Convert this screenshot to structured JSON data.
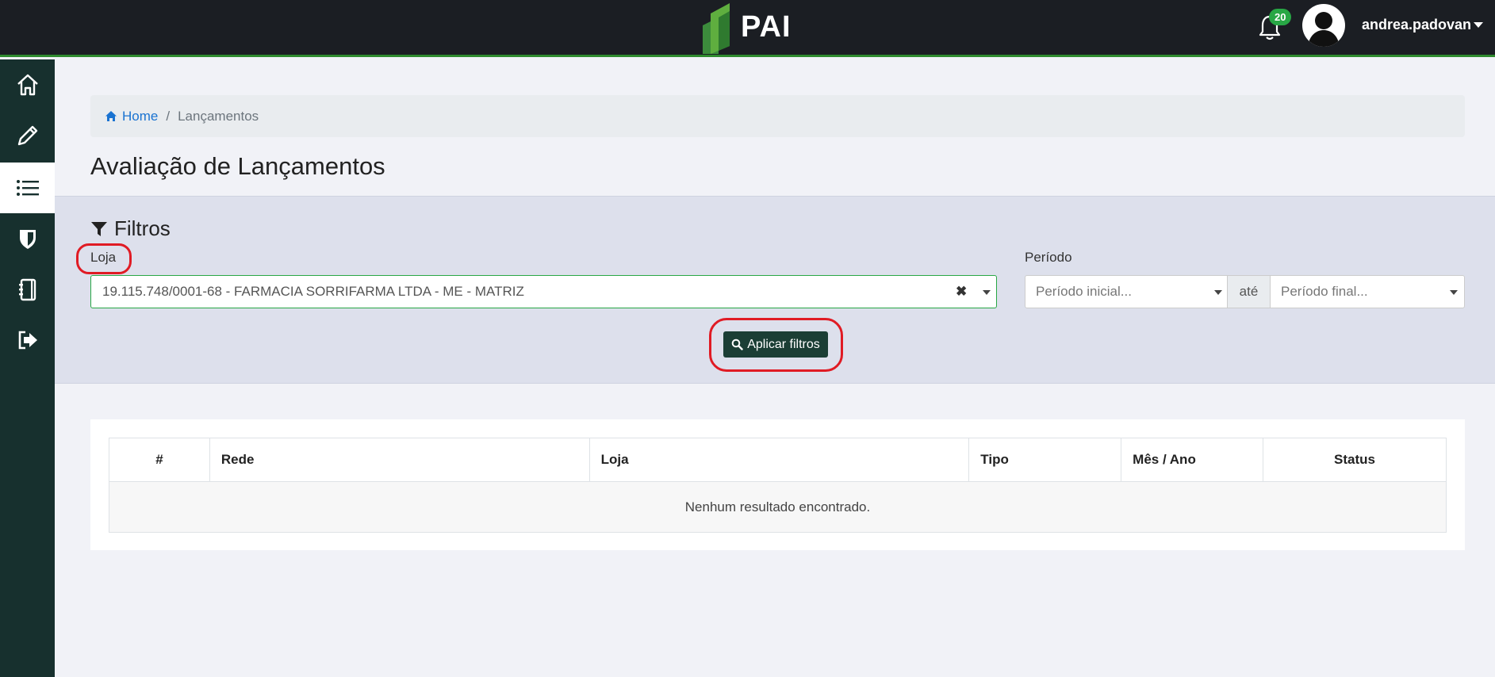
{
  "header": {
    "logo_text": "PAI",
    "notification_count": "20",
    "username": "andrea.padovan",
    "colors": {
      "bar": "#1b1e23",
      "accent": "#2e8b2e",
      "badge": "#28a745"
    }
  },
  "sidebar": {
    "items": [
      {
        "icon": "home-icon"
      },
      {
        "icon": "pencil-icon"
      },
      {
        "icon": "list-icon",
        "active": true
      },
      {
        "icon": "shield-icon"
      },
      {
        "icon": "notebook-icon"
      },
      {
        "icon": "logout-icon"
      }
    ]
  },
  "breadcrumb": {
    "home": "Home",
    "current": "Lançamentos"
  },
  "page": {
    "title": "Avaliação de Lançamentos"
  },
  "filters": {
    "title": "Filtros",
    "loja_label": "Loja",
    "loja_value": "19.115.748/0001-68 - FARMACIA SORRIFARMA LTDA - ME - MATRIZ",
    "periodo_label": "Período",
    "periodo_inicial_placeholder": "Período inicial...",
    "ate": "até",
    "periodo_final_placeholder": "Período final...",
    "apply_label": "Aplicar filtros"
  },
  "table": {
    "columns": [
      "#",
      "Rede",
      "Loja",
      "Tipo",
      "Mês / Ano",
      "Status"
    ],
    "empty_message": "Nenhum resultado encontrado."
  }
}
